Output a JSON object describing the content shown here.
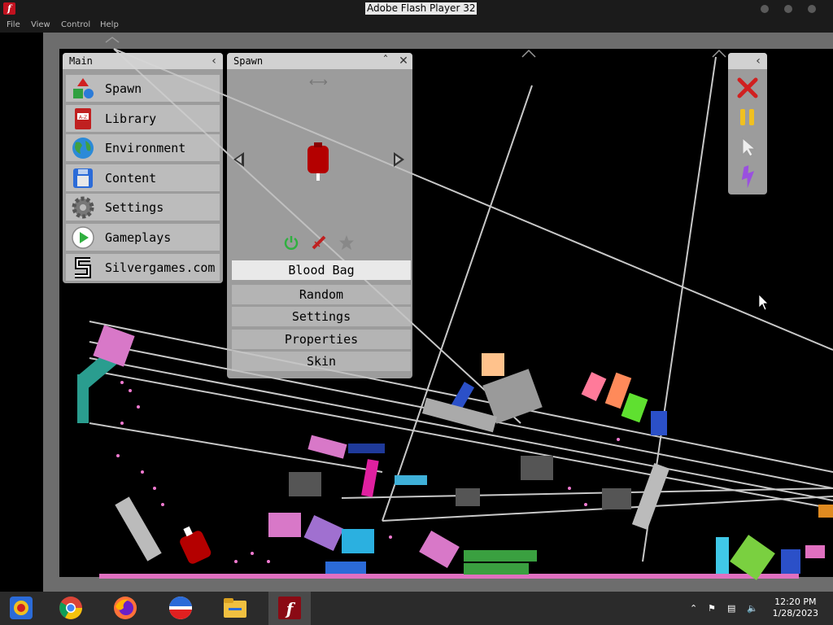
{
  "window": {
    "title": "Adobe Flash Player 32",
    "app_icon": "flash-icon"
  },
  "menubar": {
    "items": [
      "File",
      "View",
      "Control",
      "Help"
    ]
  },
  "main_panel": {
    "title": "Main",
    "collapse_icon": "chevron-left-icon",
    "items": [
      {
        "label": "Spawn",
        "icon": "shapes-icon"
      },
      {
        "label": "Library",
        "icon": "book-icon"
      },
      {
        "label": "Environment",
        "icon": "globe-icon"
      },
      {
        "label": "Content",
        "icon": "floppy-disk-icon"
      },
      {
        "label": "Settings",
        "icon": "gear-icon"
      },
      {
        "label": "Gameplays",
        "icon": "play-icon"
      },
      {
        "label": "Silvergames.com",
        "icon": "silvergames-logo-icon"
      }
    ]
  },
  "spawn_panel": {
    "title": "Spawn",
    "selected_item": "Blood Bag",
    "preview_icon": "blood-bag-icon",
    "options": [
      "Random",
      "Settings",
      "Properties",
      "Skin"
    ]
  },
  "toolbar": {
    "icons": [
      "chevron-left-icon",
      "close-x-icon",
      "pause-icon",
      "cursor-icon",
      "lightning-icon"
    ]
  },
  "taskbar": {
    "apps": [
      "ie-tab-icon",
      "chrome-icon",
      "firefox-icon",
      "obs-icon",
      "file-explorer-icon",
      "flash-player-icon"
    ],
    "time": "12:20 PM",
    "date": "1/28/2023"
  },
  "colors": {
    "blood": "#b40000",
    "panel": "#bebebe",
    "stage_border": "#6d6d6d"
  }
}
